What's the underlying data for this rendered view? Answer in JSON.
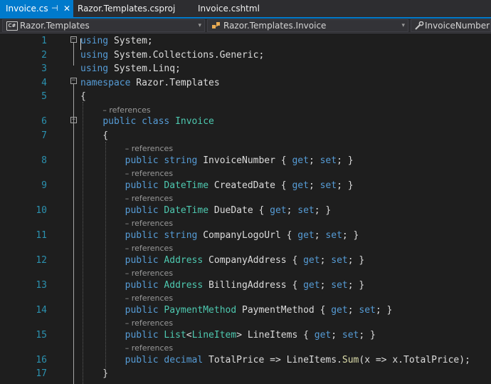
{
  "tabs": [
    {
      "label": "Invoice.cs",
      "active": true,
      "pin_icon": "pin-icon",
      "close_icon": "close-icon"
    },
    {
      "label": "Razor.Templates.csproj",
      "active": false
    },
    {
      "label": "Invoice.cshtml",
      "active": false
    }
  ],
  "nav": {
    "project": {
      "label": "Razor.Templates",
      "icon": "csharp-project-icon",
      "badge": "C#"
    },
    "type": {
      "label": "Razor.Templates.Invoice",
      "icon": "class-icon"
    },
    "member": {
      "label": "InvoiceNumber",
      "icon": "wrench-icon"
    }
  },
  "editor": {
    "codelens_text": "– references",
    "colors": {
      "keyword": "#569cd6",
      "type": "#4ec9b0",
      "method": "#dcdcaa",
      "plain": "#dcdcdc",
      "line_number": "#2b91af",
      "codelens": "#999999",
      "background": "#1e1e1e",
      "accent": "#007acc"
    },
    "lines": [
      {
        "num": "1",
        "lens": false,
        "tokens": [
          [
            "kw",
            "using"
          ],
          [
            "pl",
            " System;"
          ]
        ]
      },
      {
        "num": "2",
        "lens": false,
        "tokens": [
          [
            "kw",
            "using"
          ],
          [
            "pl",
            " System.Collections.Generic;"
          ]
        ]
      },
      {
        "num": "3",
        "lens": false,
        "tokens": [
          [
            "kw",
            "using"
          ],
          [
            "pl",
            " System.Linq;"
          ]
        ]
      },
      {
        "num": "4",
        "lens": false,
        "tokens": [
          [
            "kw",
            "namespace"
          ],
          [
            "pl",
            " Razor.Templates"
          ]
        ]
      },
      {
        "num": "5",
        "lens": false,
        "tokens": [
          [
            "pl",
            "{"
          ]
        ]
      },
      {
        "num": "6",
        "lens": true,
        "tokens": [
          [
            "pl",
            "    "
          ],
          [
            "kw",
            "public"
          ],
          [
            "pl",
            " "
          ],
          [
            "kw",
            "class"
          ],
          [
            "pl",
            " "
          ],
          [
            "typ",
            "Invoice"
          ]
        ]
      },
      {
        "num": "7",
        "lens": false,
        "tokens": [
          [
            "pl",
            "    {"
          ]
        ]
      },
      {
        "num": "8",
        "lens": true,
        "tokens": [
          [
            "pl",
            "        "
          ],
          [
            "kw",
            "public"
          ],
          [
            "pl",
            " "
          ],
          [
            "kw",
            "string"
          ],
          [
            "pl",
            " InvoiceNumber { "
          ],
          [
            "kw",
            "get"
          ],
          [
            "pl",
            "; "
          ],
          [
            "kw",
            "set"
          ],
          [
            "pl",
            "; }"
          ]
        ]
      },
      {
        "num": "9",
        "lens": true,
        "tokens": [
          [
            "pl",
            "        "
          ],
          [
            "kw",
            "public"
          ],
          [
            "pl",
            " "
          ],
          [
            "typ",
            "DateTime"
          ],
          [
            "pl",
            " CreatedDate { "
          ],
          [
            "kw",
            "get"
          ],
          [
            "pl",
            "; "
          ],
          [
            "kw",
            "set"
          ],
          [
            "pl",
            "; }"
          ]
        ]
      },
      {
        "num": "10",
        "lens": true,
        "tokens": [
          [
            "pl",
            "        "
          ],
          [
            "kw",
            "public"
          ],
          [
            "pl",
            " "
          ],
          [
            "typ",
            "DateTime"
          ],
          [
            "pl",
            " DueDate { "
          ],
          [
            "kw",
            "get"
          ],
          [
            "pl",
            "; "
          ],
          [
            "kw",
            "set"
          ],
          [
            "pl",
            "; }"
          ]
        ]
      },
      {
        "num": "11",
        "lens": true,
        "tokens": [
          [
            "pl",
            "        "
          ],
          [
            "kw",
            "public"
          ],
          [
            "pl",
            " "
          ],
          [
            "kw",
            "string"
          ],
          [
            "pl",
            " CompanyLogoUrl { "
          ],
          [
            "kw",
            "get"
          ],
          [
            "pl",
            "; "
          ],
          [
            "kw",
            "set"
          ],
          [
            "pl",
            "; }"
          ]
        ]
      },
      {
        "num": "12",
        "lens": true,
        "tokens": [
          [
            "pl",
            "        "
          ],
          [
            "kw",
            "public"
          ],
          [
            "pl",
            " "
          ],
          [
            "typ",
            "Address"
          ],
          [
            "pl",
            " CompanyAddress { "
          ],
          [
            "kw",
            "get"
          ],
          [
            "pl",
            "; "
          ],
          [
            "kw",
            "set"
          ],
          [
            "pl",
            "; }"
          ]
        ]
      },
      {
        "num": "13",
        "lens": true,
        "tokens": [
          [
            "pl",
            "        "
          ],
          [
            "kw",
            "public"
          ],
          [
            "pl",
            " "
          ],
          [
            "typ",
            "Address"
          ],
          [
            "pl",
            " BillingAddress { "
          ],
          [
            "kw",
            "get"
          ],
          [
            "pl",
            "; "
          ],
          [
            "kw",
            "set"
          ],
          [
            "pl",
            "; }"
          ]
        ]
      },
      {
        "num": "14",
        "lens": true,
        "tokens": [
          [
            "pl",
            "        "
          ],
          [
            "kw",
            "public"
          ],
          [
            "pl",
            " "
          ],
          [
            "typ",
            "PaymentMethod"
          ],
          [
            "pl",
            " PaymentMethod { "
          ],
          [
            "kw",
            "get"
          ],
          [
            "pl",
            "; "
          ],
          [
            "kw",
            "set"
          ],
          [
            "pl",
            "; }"
          ]
        ]
      },
      {
        "num": "15",
        "lens": true,
        "tokens": [
          [
            "pl",
            "        "
          ],
          [
            "kw",
            "public"
          ],
          [
            "pl",
            " "
          ],
          [
            "typ",
            "List"
          ],
          [
            "pl",
            "<"
          ],
          [
            "typ",
            "LineItem"
          ],
          [
            "pl",
            "> LineItems { "
          ],
          [
            "kw",
            "get"
          ],
          [
            "pl",
            "; "
          ],
          [
            "kw",
            "set"
          ],
          [
            "pl",
            "; }"
          ]
        ]
      },
      {
        "num": "16",
        "lens": true,
        "tokens": [
          [
            "pl",
            "        "
          ],
          [
            "kw",
            "public"
          ],
          [
            "pl",
            " "
          ],
          [
            "kw",
            "decimal"
          ],
          [
            "pl",
            " TotalPrice => LineItems."
          ],
          [
            "mth",
            "Sum"
          ],
          [
            "pl",
            "(x => x.TotalPrice);"
          ]
        ]
      },
      {
        "num": "17",
        "lens": false,
        "tokens": [
          [
            "pl",
            "    }"
          ]
        ]
      }
    ]
  }
}
